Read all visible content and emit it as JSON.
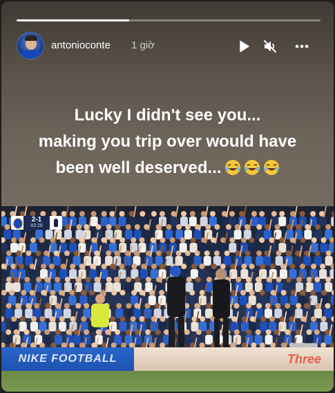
{
  "story": {
    "progress": 0.37,
    "username": "antonioconte",
    "timestamp": "1 giờ",
    "caption_lines": [
      "Lucky I didn't see you...",
      "making you trip over would have",
      "been well deserved..."
    ],
    "emoji": [
      "face-with-tears-of-joy",
      "face-with-tears-of-joy",
      "face-with-tears-of-joy"
    ]
  },
  "controls": {
    "play_icon": "play-icon",
    "mute_icon": "muted-speaker-icon",
    "more_icon": "more-options-icon"
  },
  "photo": {
    "scorebug": {
      "score": "2-1",
      "clock": "83:26"
    },
    "ad_left": "NIKE FOOTBALL",
    "ad_right": "Three"
  },
  "colors": {
    "story_background": "#5b5249",
    "caption_text": "#ffffff",
    "progress_fill": "#ffffff",
    "ad_left": "#2a66c9",
    "ad_right_text": "#e65f4a"
  }
}
